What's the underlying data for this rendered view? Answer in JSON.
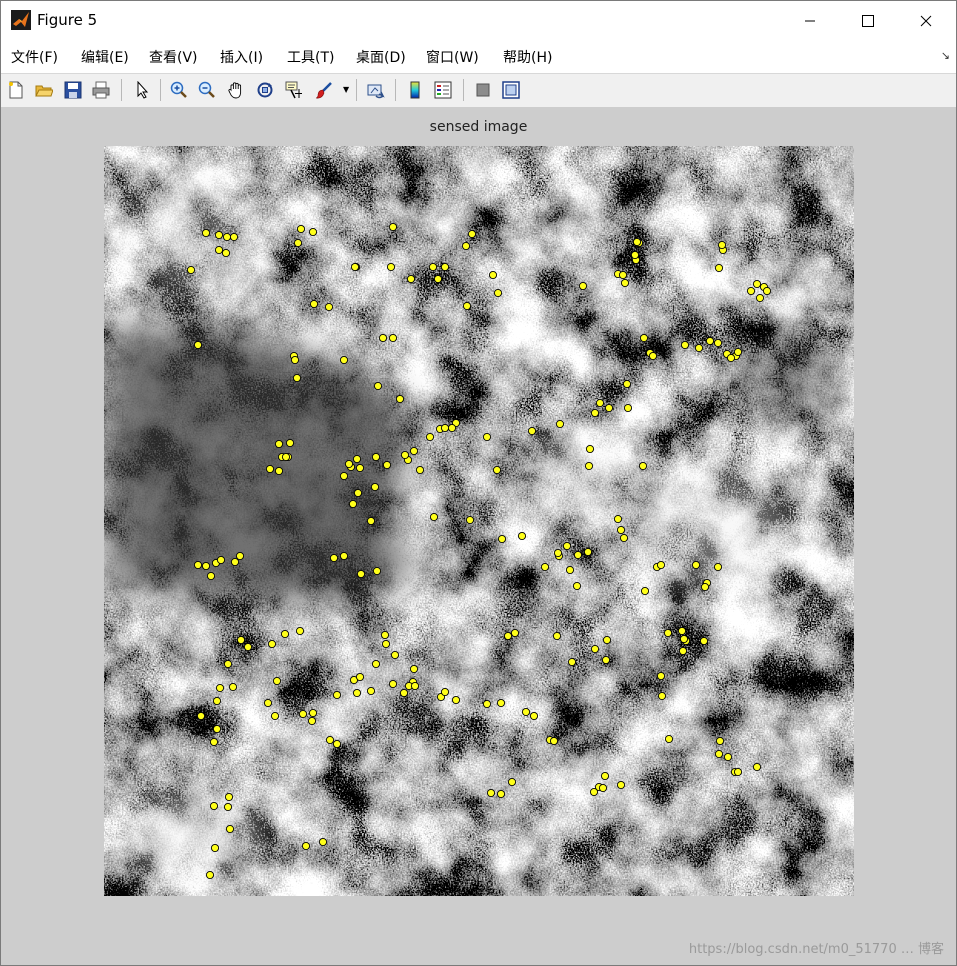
{
  "window": {
    "title": "Figure 5"
  },
  "menu": [
    {
      "label": "文件(F)"
    },
    {
      "label": "编辑(E)"
    },
    {
      "label": "查看(V)"
    },
    {
      "label": "插入(I)"
    },
    {
      "label": "工具(T)"
    },
    {
      "label": "桌面(D)"
    },
    {
      "label": "窗口(W)"
    },
    {
      "label": "帮助(H)"
    }
  ],
  "toolbar": [
    "new-figure-icon",
    "open-file-icon",
    "save-icon",
    "print-icon",
    "edit-plot-arrow-icon",
    "zoom-in-icon",
    "zoom-out-icon",
    "pan-hand-icon",
    "rotate-3d-icon",
    "data-cursor-icon",
    "brush-icon",
    "link-plot-icon",
    "colorbar-icon",
    "legend-icon",
    "hide-plot-tools-icon",
    "show-plot-tools-icon"
  ],
  "figure": {
    "axes_title": "sensed image",
    "marker_color": "#ffff1a"
  },
  "watermark": "https://blog.csdn.net/m0_51770 … 博客"
}
